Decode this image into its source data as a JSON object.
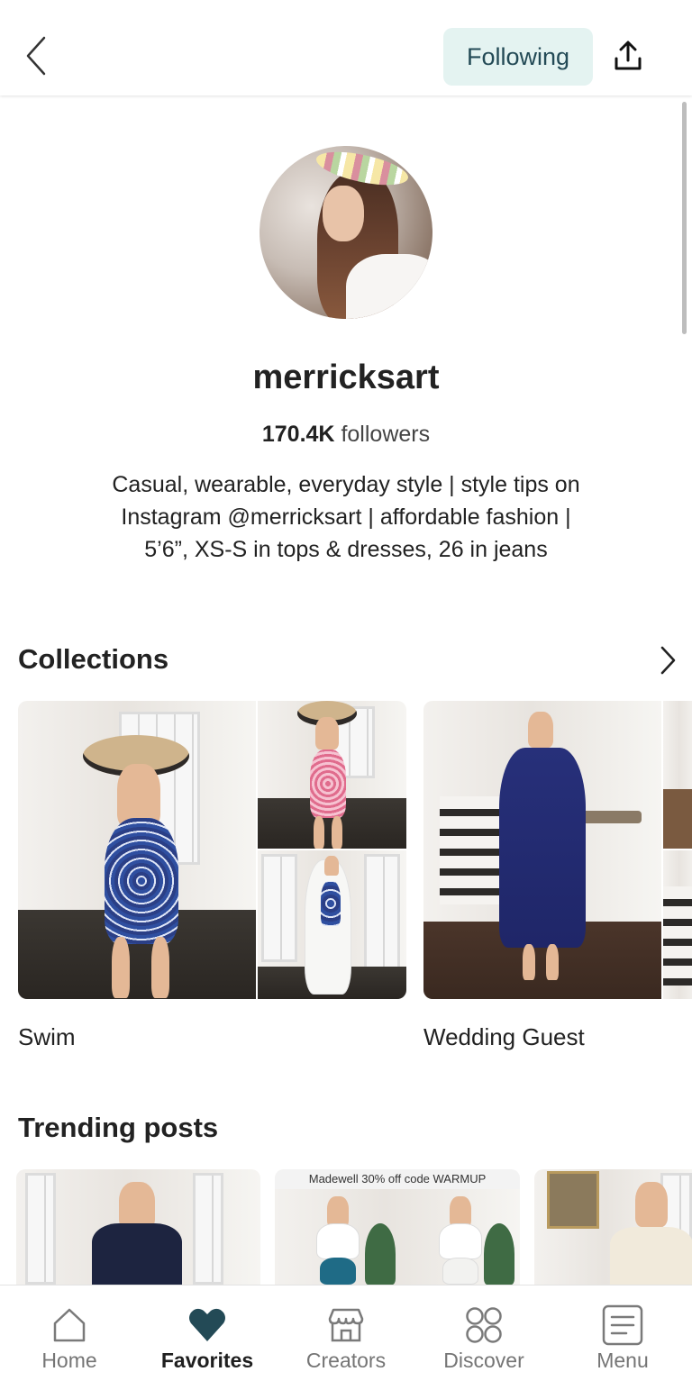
{
  "header": {
    "follow_label": "Following",
    "icons": {
      "back": "chevron-left-icon",
      "share": "share-upload-icon"
    }
  },
  "profile": {
    "username": "merricksart",
    "followers_count": "170.4K",
    "followers_label": "followers",
    "bio_lines": [
      "Casual, wearable, everyday style | style tips on",
      "Instagram @merricksart | affordable fashion |",
      "5’6”,  XS-S in tops & dresses, 26 in jeans"
    ]
  },
  "collections": {
    "title": "Collections",
    "items": [
      {
        "label": "Swim"
      },
      {
        "label": "Wedding Guest"
      }
    ]
  },
  "trending": {
    "title": "Trending posts",
    "posts": [
      {
        "banner": ""
      },
      {
        "banner": "Madewell 30% off code WARMUP"
      },
      {
        "banner": ""
      }
    ]
  },
  "tabbar": {
    "tabs": [
      {
        "label": "Home",
        "icon": "home-icon",
        "active": false
      },
      {
        "label": "Favorites",
        "icon": "heart-icon",
        "active": true
      },
      {
        "label": "Creators",
        "icon": "storefront-icon",
        "active": false
      },
      {
        "label": "Discover",
        "icon": "grid-circles-icon",
        "active": false
      },
      {
        "label": "Menu",
        "icon": "menu-list-icon",
        "active": false
      }
    ]
  },
  "colors": {
    "accent": "#234a56",
    "follow_bg": "#e4f3f1",
    "text": "#1f1f1f",
    "muted": "#757575"
  }
}
